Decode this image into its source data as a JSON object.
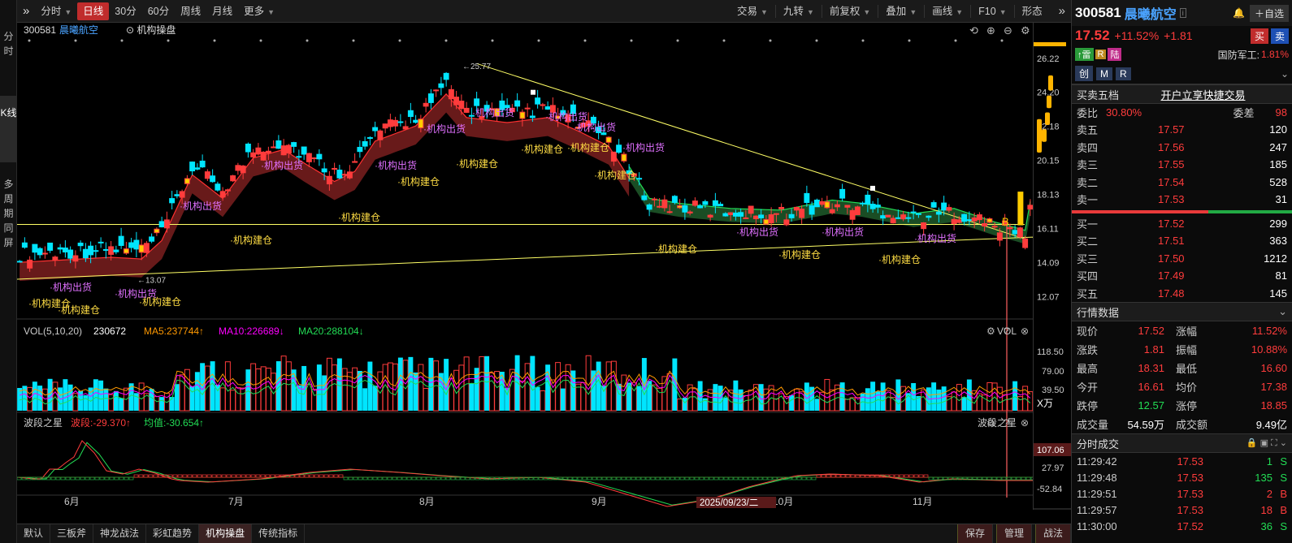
{
  "rail": [
    "分时",
    "K线",
    "多周期同屏"
  ],
  "toolbar": {
    "left": [
      "分时",
      "日线",
      "30分",
      "60分",
      "周线",
      "月线",
      "更多"
    ],
    "right": [
      "交易",
      "九转",
      "前复权",
      "叠加",
      "画线",
      "F10",
      "形态"
    ]
  },
  "stock": {
    "code": "300581",
    "name": "晨曦航空",
    "price": "17.52",
    "pct": "+11.52%",
    "chg": "+1.81",
    "sector": "国防军工:",
    "sector_pct": "1.81%",
    "subscribe": "自选",
    "buy": "买",
    "sell": "卖",
    "tags": [
      "雷",
      "R",
      "陆"
    ],
    "btns": [
      "创",
      "M",
      "R"
    ]
  },
  "chart": {
    "header_code": "300581",
    "header_name": "晨曦航空",
    "header_label": "机构操盘",
    "y_ticks": [
      "26.22",
      "24.20",
      "22.18",
      "20.15",
      "18.13",
      "16.11",
      "14.09",
      "12.07"
    ],
    "high_label": "25.77",
    "low_label": "13.07",
    "b_label": "B",
    "x_ticks": [
      "6月",
      "7月",
      "8月",
      "9月",
      "10月",
      "11月"
    ],
    "cursor_date": "2025/09/23/二",
    "period": "日线",
    "ann_sell": "机构出货",
    "ann_buy": "机构建仓"
  },
  "vol": {
    "title": "VOL(5,10,20)",
    "value": "230672",
    "ma5": "MA5:237744",
    "ma10": "MA10:226689",
    "ma20": "MA20:288104",
    "right": "VOL",
    "ticks": [
      "118.50",
      "79.00",
      "39.50"
    ],
    "unit": "X万"
  },
  "wave": {
    "title": "波段之星",
    "v1": "波段:-29.370",
    "v2": "均值:-30.654",
    "right": "波段之星",
    "ticks": [
      "107.06",
      "27.97",
      "-52.84"
    ]
  },
  "bottom_tabs": [
    "默认",
    "三板斧",
    "神龙战法",
    "彩虹趋势",
    "机构操盘",
    "传统指标"
  ],
  "bottom_right": [
    "保存",
    "管理",
    "战法"
  ],
  "order_book": {
    "title": "买卖五档",
    "link": "开户立享快捷交易",
    "ratio_label": "委比",
    "ratio": "30.80%",
    "diff_label": "委差",
    "diff": "98",
    "asks": [
      [
        "卖五",
        "17.57",
        "120"
      ],
      [
        "卖四",
        "17.56",
        "247"
      ],
      [
        "卖三",
        "17.55",
        "185"
      ],
      [
        "卖二",
        "17.54",
        "528"
      ],
      [
        "卖一",
        "17.53",
        "31"
      ]
    ],
    "bids": [
      [
        "买一",
        "17.52",
        "299"
      ],
      [
        "买二",
        "17.51",
        "363"
      ],
      [
        "买三",
        "17.50",
        "1212"
      ],
      [
        "买四",
        "17.49",
        "81"
      ],
      [
        "买五",
        "17.48",
        "145"
      ]
    ]
  },
  "quote": {
    "title": "行情数据",
    "rows": [
      [
        "现价",
        "17.52",
        "涨幅",
        "11.52%"
      ],
      [
        "涨跌",
        "1.81",
        "振幅",
        "10.88%"
      ],
      [
        "最高",
        "18.31",
        "最低",
        "16.60"
      ],
      [
        "今开",
        "16.61",
        "均价",
        "17.38"
      ],
      [
        "跌停",
        "12.57",
        "涨停",
        "18.85"
      ],
      [
        "成交量",
        "54.59万",
        "成交额",
        "9.49亿"
      ]
    ]
  },
  "ticks": {
    "title": "分时成交",
    "rows": [
      [
        "11:29:42",
        "17.53",
        "1",
        "S"
      ],
      [
        "11:29:48",
        "17.53",
        "135",
        "S"
      ],
      [
        "11:29:51",
        "17.53",
        "2",
        "B"
      ],
      [
        "11:29:57",
        "17.53",
        "18",
        "B"
      ],
      [
        "11:30:00",
        "17.52",
        "36",
        "S"
      ]
    ]
  },
  "colors": {
    "up": "#ff3c3c",
    "down": "#00e5ff",
    "ma5": "#ff9900",
    "ma10": "#ff00ff",
    "ma20": "#22dd55",
    "trend": "#ffff66"
  }
}
